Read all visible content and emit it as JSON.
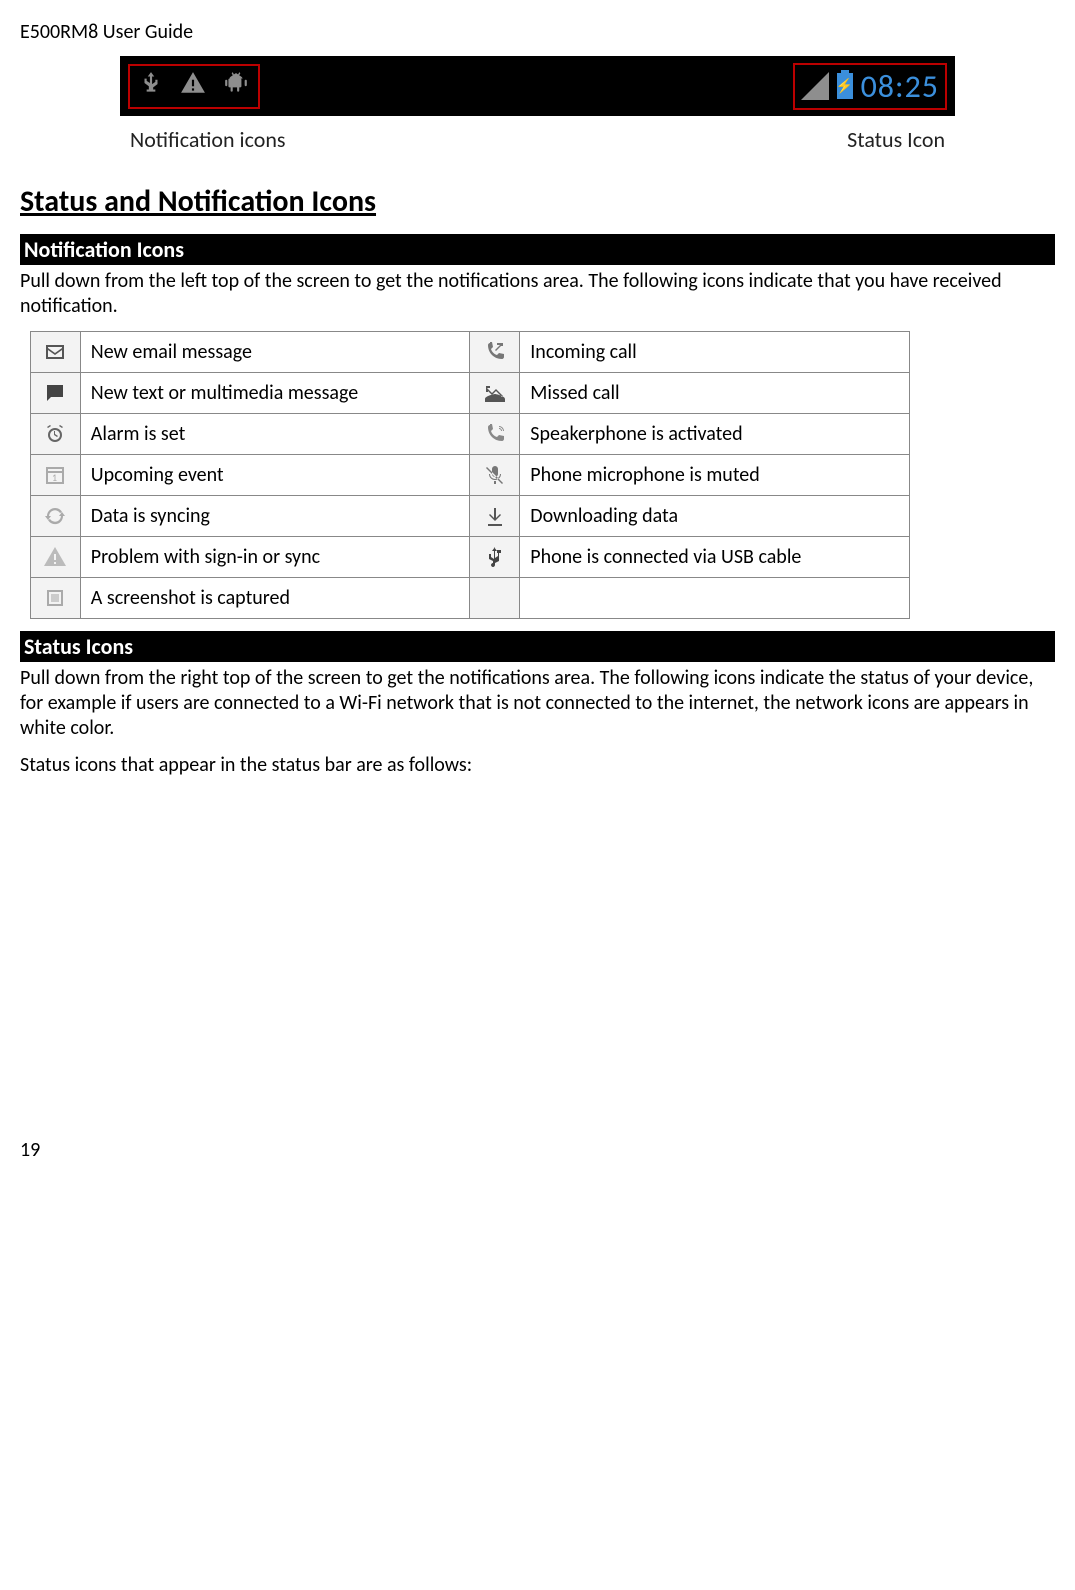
{
  "header": {
    "title": "E500RM8 User Guide"
  },
  "statusbar_figure": {
    "clock": "08:25",
    "caption_left": "Notification icons",
    "caption_right": "Status Icon"
  },
  "section_title": "Status and Notification Icons",
  "notification_icons": {
    "heading": "Notification Icons",
    "intro": "Pull down from the left top of the screen to get the notifications area. The following icons indicate that you have received notification.",
    "rows": [
      {
        "left": "New email message",
        "right": "Incoming call"
      },
      {
        "left": "New text or multimedia message",
        "right": "Missed call"
      },
      {
        "left": "Alarm is set",
        "right": "Speakerphone is activated"
      },
      {
        "left": "Upcoming event",
        "right": "Phone microphone is muted"
      },
      {
        "left": "Data is syncing",
        "right": "Downloading data"
      },
      {
        "left": "Problem with sign-in or sync",
        "right": "Phone is connected via USB cable"
      },
      {
        "left": "A screenshot is captured",
        "right": ""
      }
    ]
  },
  "status_icons": {
    "heading": "Status Icons",
    "intro": "Pull down from the right top of the screen to get the notifications area. The following icons indicate the status of your device, for example if users are connected to a Wi-Fi network that is not connected to the internet, the network icons are appears in white color.",
    "note": "Status icons that appear in the status bar are as follows:"
  },
  "page_num": "19"
}
